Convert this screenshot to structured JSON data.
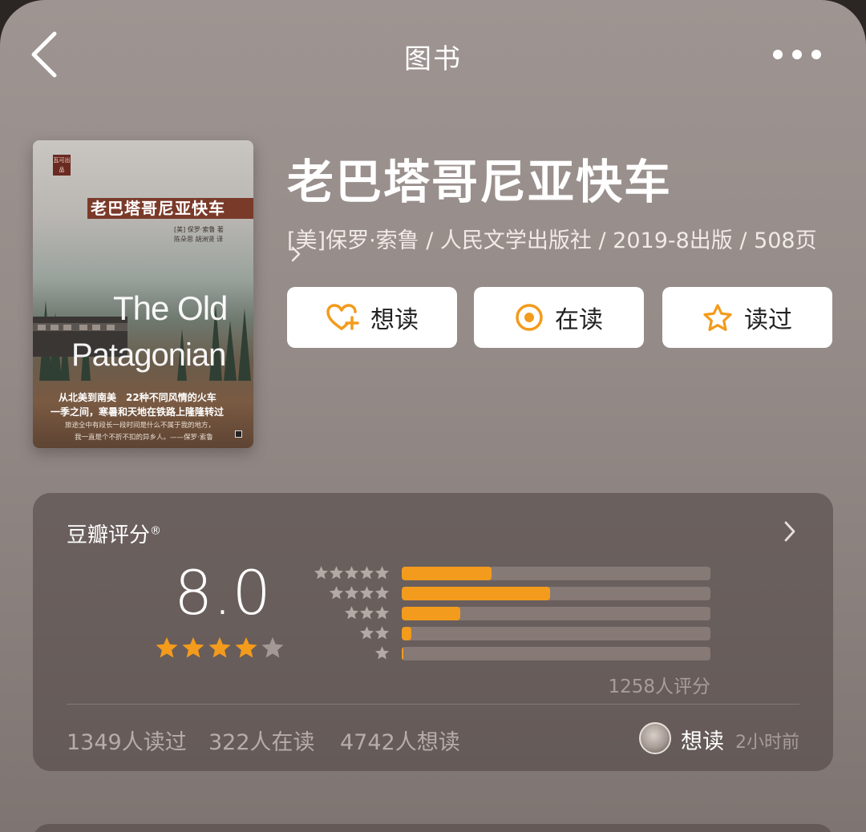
{
  "nav": {
    "title": "图书"
  },
  "book": {
    "title": "老巴塔哥尼亚快车",
    "meta": "[美]保罗·索鲁 / 人民文学出版社 / 2019-8出版 / 508页",
    "cover": {
      "logo_text": "瓦可出品",
      "title": "老巴塔哥尼亚快车",
      "authors_line1": "[美] 保罗·索鲁 著",
      "authors_line2": "陈朵思 胡洲贤 译",
      "english_line1": "The Old",
      "english_line2": "Patagonian",
      "tagline1": "从北美到南美　22种不同风情的火车",
      "tagline2": "一季之间，寒暑和天地在铁路上隆隆转过",
      "tagline3": "旅途全中有段长一段时间是什么不属于我的地方，",
      "tagline4": "我一直是个不折不扣的异乡人。——保罗·索鲁"
    }
  },
  "actions": {
    "want": {
      "label": "想读",
      "icon": "heart-plus-icon"
    },
    "reading": {
      "label": "在读",
      "icon": "target-icon"
    },
    "read": {
      "label": "读过",
      "icon": "star-outline-icon"
    }
  },
  "rating": {
    "title": "豆瓣评分",
    "registered": "®",
    "score": "8.0",
    "stars_filled": 4,
    "stars_total": 5,
    "distribution": [
      {
        "stars": 5,
        "fraction": 0.29
      },
      {
        "stars": 4,
        "fraction": 0.48
      },
      {
        "stars": 3,
        "fraction": 0.19
      },
      {
        "stars": 2,
        "fraction": 0.03
      },
      {
        "stars": 1,
        "fraction": 0.005
      }
    ],
    "total": "1258人评分",
    "stats": {
      "read": "1349人读过",
      "reading": "322人在读",
      "want": "4742人想读"
    },
    "recent": {
      "action": "想读",
      "time": "2小时前"
    }
  },
  "colors": {
    "accent": "#f39b1c",
    "background": "#9a908d",
    "card": "#5e5452"
  }
}
